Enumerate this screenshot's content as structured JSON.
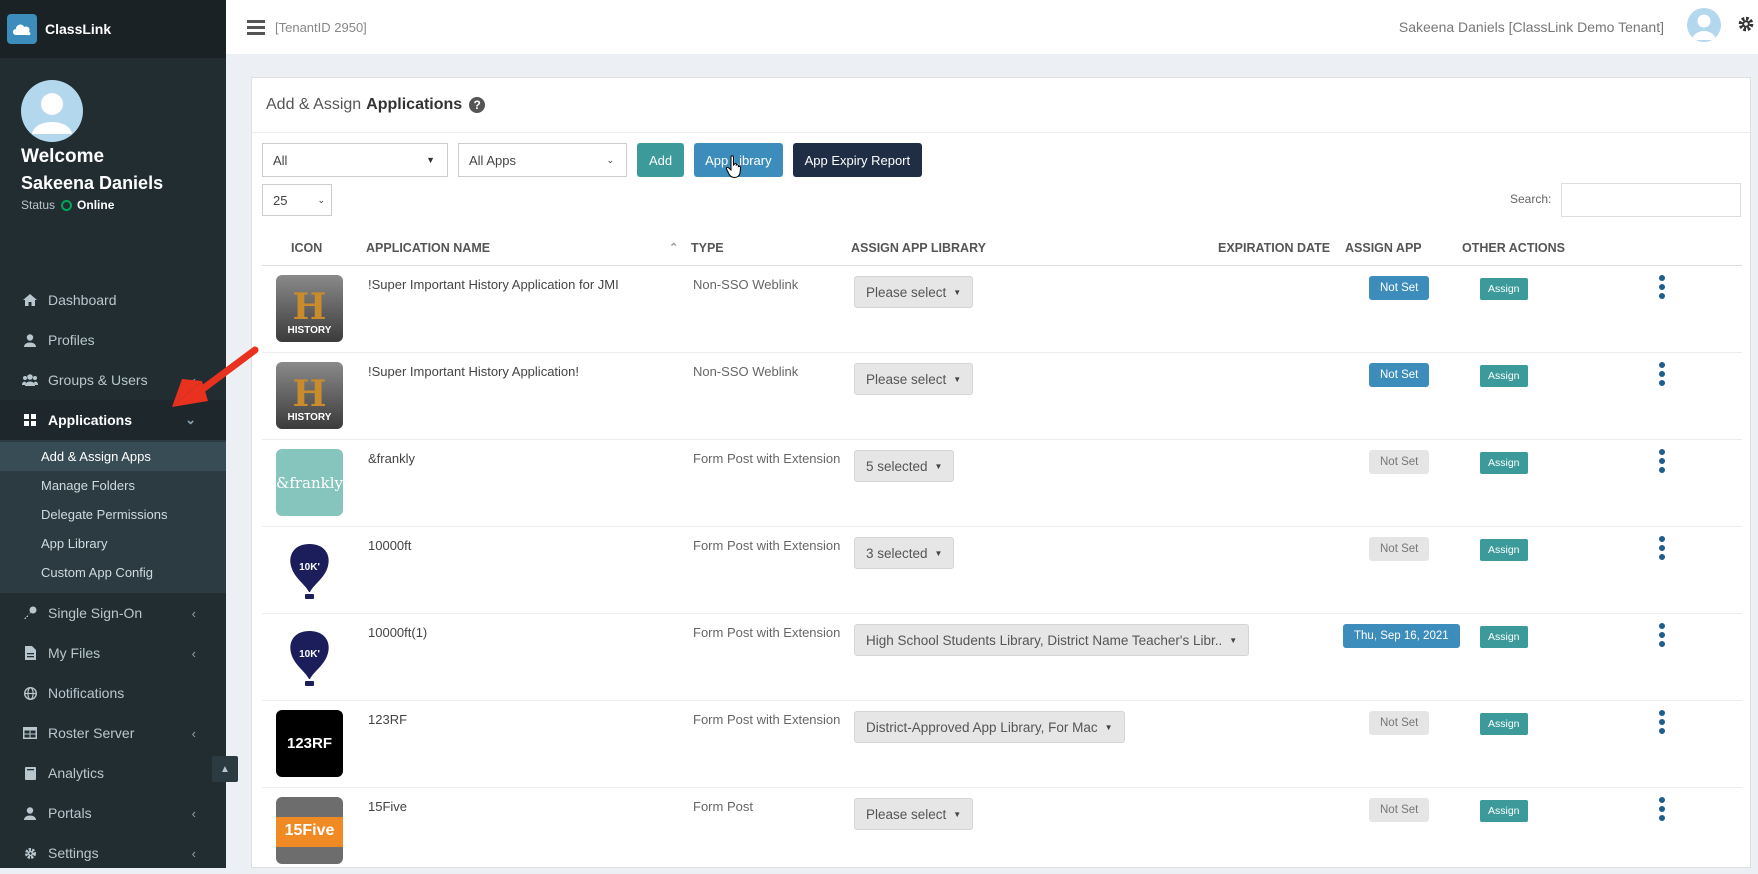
{
  "brand": {
    "name": "ClassLink"
  },
  "user_panel": {
    "welcome": "Welcome",
    "name": "Sakeena Daniels",
    "status_label": "Status",
    "status_value": "Online"
  },
  "sidebar": {
    "items": [
      {
        "label": "Dashboard",
        "icon": "dashboard-icon"
      },
      {
        "label": "Profiles",
        "icon": "user-icon"
      },
      {
        "label": "Groups & Users",
        "icon": "users-icon"
      },
      {
        "label": "Applications",
        "icon": "grid-icon"
      },
      {
        "label": "Single Sign-On",
        "icon": "key-icon"
      },
      {
        "label": "My Files",
        "icon": "file-icon"
      },
      {
        "label": "Notifications",
        "icon": "globe-icon"
      },
      {
        "label": "Roster Server",
        "icon": "table-icon"
      },
      {
        "label": "Analytics",
        "icon": "book-icon"
      },
      {
        "label": "Portals",
        "icon": "user-icon"
      },
      {
        "label": "Settings",
        "icon": "gear-icon"
      }
    ],
    "submenu": [
      "Add & Assign Apps",
      "Manage Folders",
      "Delegate Permissions",
      "App Library",
      "Custom App Config"
    ]
  },
  "topbar": {
    "tenant": "[TenantID 2950]",
    "user": "Sakeena Daniels [ClassLink Demo Tenant]"
  },
  "page": {
    "title_prefix": "Add & Assign",
    "title_bold": "Applications",
    "filter1": "All",
    "filter2": "All Apps",
    "add_button": "Add",
    "library_button": "App Library",
    "expiry_button": "App Expiry Report",
    "page_length": "25",
    "search_label": "Search:"
  },
  "table": {
    "headers": [
      "ICON",
      "APPLICATION NAME",
      "TYPE",
      "ASSIGN APP LIBRARY",
      "EXPIRATION DATE",
      "ASSIGN APP",
      "OTHER ACTIONS"
    ],
    "rows": [
      {
        "name": "!Super Important History Application for JMI",
        "type": "Non-SSO Weblink",
        "library": "Please select",
        "expiration": "Not Set",
        "expiration_set": true,
        "assign": "Assign",
        "icon": "history-icon"
      },
      {
        "name": "!Super Important History Application!",
        "type": "Non-SSO Weblink",
        "library": "Please select",
        "expiration": "Not Set",
        "expiration_set": true,
        "assign": "Assign",
        "icon": "history-icon"
      },
      {
        "name": "&frankly",
        "type": "Form Post with Extension",
        "library": "5 selected",
        "expiration": "Not Set",
        "expiration_set": false,
        "assign": "Assign",
        "icon": "frankly-icon",
        "icon_text": "&frankly"
      },
      {
        "name": "10000ft",
        "type": "Form Post with Extension",
        "library": "3 selected",
        "expiration": "Not Set",
        "expiration_set": false,
        "assign": "Assign",
        "icon": "balloon-icon"
      },
      {
        "name": "10000ft(1)",
        "type": "Form Post with Extension",
        "library": "High School Students Library, District Name Teacher's Libr..",
        "expiration": "Thu, Sep 16, 2021",
        "expiration_set": true,
        "assign": "Assign",
        "icon": "balloon-icon"
      },
      {
        "name": "123RF",
        "type": "Form Post with Extension",
        "library": "District-Approved App Library, For Mac",
        "expiration": "Not Set",
        "expiration_set": false,
        "assign": "Assign",
        "icon": "123rf-icon",
        "icon_text": "123RF"
      },
      {
        "name": "15Five",
        "type": "Form Post",
        "library": "Please select",
        "expiration": "Not Set",
        "expiration_set": false,
        "assign": "Assign",
        "icon": "15five-icon",
        "icon_text": "15Five"
      }
    ]
  },
  "icon_text": {
    "history_letter": "H",
    "history_word": "HISTORY",
    "balloon": "10K'"
  },
  "colors": {
    "sidebar": "#222d32",
    "primary": "#3c8dbc",
    "teal": "#3c9a9a",
    "dark_button": "#1f2e45"
  }
}
